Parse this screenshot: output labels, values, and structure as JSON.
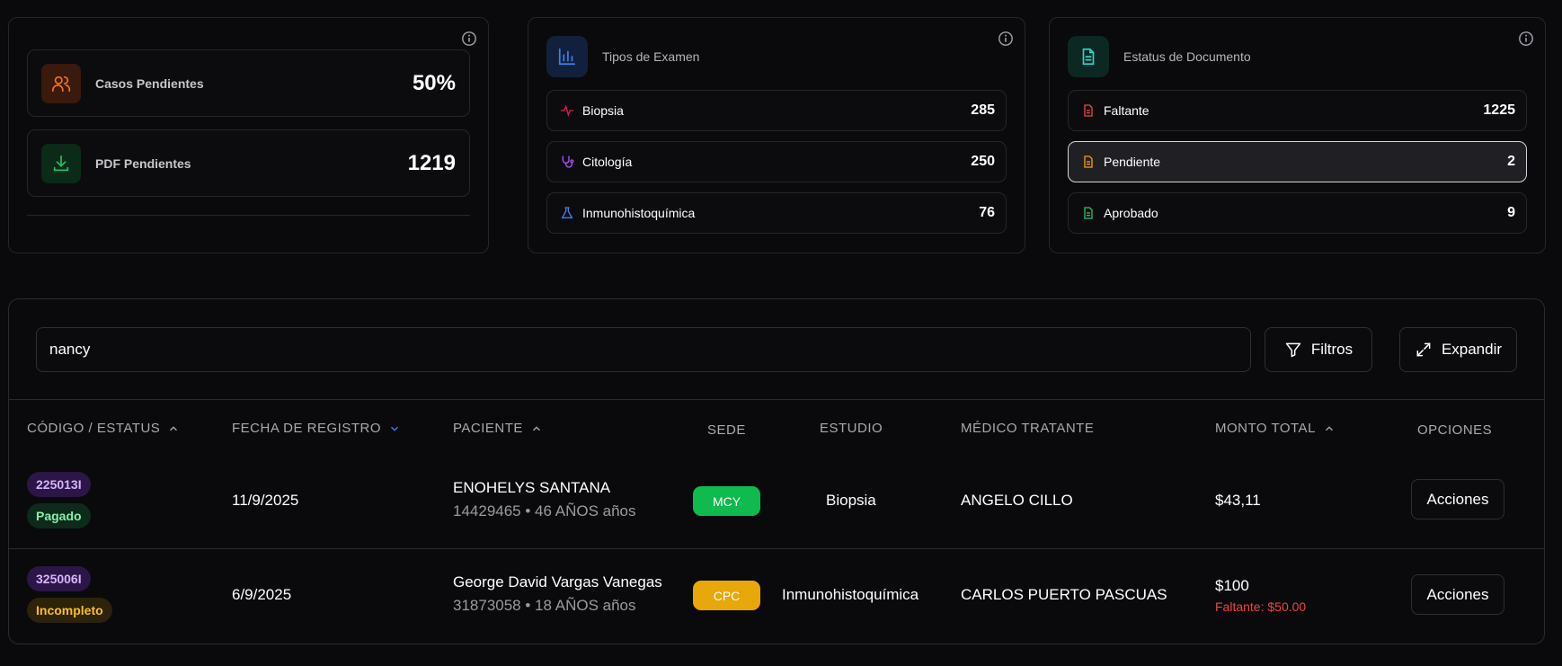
{
  "card1": {
    "casos_label": "Casos Pendientes",
    "casos_value": "50%",
    "pdf_label": "PDF Pendientes",
    "pdf_value": "1219"
  },
  "card2": {
    "title": "Tipos de Examen",
    "items": [
      {
        "label": "Biopsia",
        "value": "285"
      },
      {
        "label": "Citología",
        "value": "250"
      },
      {
        "label": "Inmunohistoquímica",
        "value": "76"
      }
    ]
  },
  "card3": {
    "title": "Estatus de Documento",
    "items": [
      {
        "label": "Faltante",
        "value": "1225"
      },
      {
        "label": "Pendiente",
        "value": "2"
      },
      {
        "label": "Aprobado",
        "value": "9"
      }
    ]
  },
  "toolbar": {
    "search_value": "nancy",
    "filters_label": "Filtros",
    "expand_label": "Expandir"
  },
  "table": {
    "headers": {
      "codigo": "CÓDIGO / ESTATUS",
      "fecha": "FECHA DE REGISTRO",
      "paciente": "PACIENTE",
      "sede": "SEDE",
      "estudio": "ESTUDIO",
      "medico": "MÉDICO TRATANTE",
      "monto": "MONTO TOTAL",
      "opciones": "OPCIONES"
    },
    "rows": [
      {
        "code": "225013I",
        "status": "Pagado",
        "date": "11/9/2025",
        "patient": "ENOHELYS SANTANA",
        "patient_id": "14429465",
        "patient_age": "46 AÑOS años",
        "sede": "MCY",
        "study": "Biopsia",
        "doctor": "ANGELO CILLO",
        "amount": "$43,11",
        "amount_note": "",
        "action": "Acciones"
      },
      {
        "code": "325006I",
        "status": "Incompleto",
        "date": "6/9/2025",
        "patient": "George David Vargas Vanegas",
        "patient_id": "31873058",
        "patient_age": "18 AÑOS años",
        "sede": "CPC",
        "study": "Inmunohistoquímica",
        "doctor": "CARLOS PUERTO PASCUAS",
        "amount": "$100",
        "amount_note": "Faltante: $50.00",
        "action": "Acciones"
      }
    ]
  },
  "colors": {
    "accent_orange": "#f97316",
    "accent_green": "#22c55e",
    "accent_blue": "#3b82f6",
    "accent_teal": "#2dd4bf",
    "sede_mcy": "#0fba4f",
    "sede_cpc": "#e8a70a",
    "faltante_red": "#ef4444"
  }
}
